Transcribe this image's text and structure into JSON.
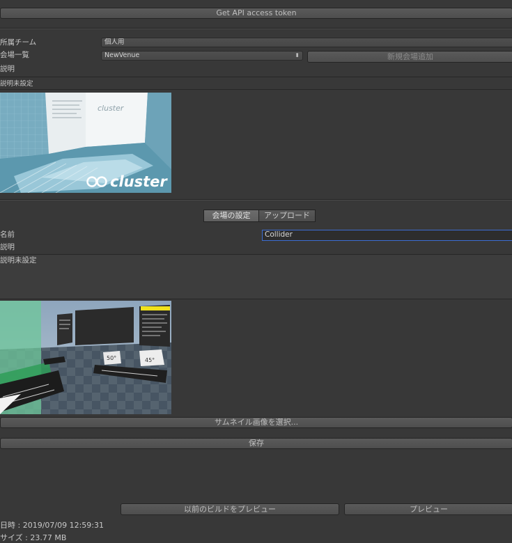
{
  "top": {
    "api_token_button": "Get API access token"
  },
  "team": {
    "label": "所属チーム",
    "value": "個人用"
  },
  "venues": {
    "label": "会場一覧",
    "selected": "NewVenue",
    "add_button": "新規会場追加"
  },
  "venue_description": {
    "label": "説明",
    "value": "説明未設定"
  },
  "venue_thumbnail": {
    "logo_text": "cluster",
    "screen_logo": "cluster"
  },
  "tabs": [
    {
      "label": "会場の設定",
      "active": true
    },
    {
      "label": "アップロード",
      "active": false
    }
  ],
  "settings": {
    "name_label": "名前",
    "name_value": "Collider",
    "description_label": "説明",
    "description_value": "説明未設定",
    "preview_labels": {
      "a": "50°",
      "b": "45°"
    },
    "select_thumbnail_button": "サムネイル画像を選択...",
    "save_button": "保存"
  },
  "build": {
    "preview_previous_button": "以前のビルドをプレビュー",
    "preview_button": "プレビュー",
    "date_text": "日時 : 2019/07/09 12:59:31",
    "size_text": "サイズ : 23.77 MB"
  },
  "colors": {
    "background": "#383838",
    "focus_border": "#3c6dd2",
    "thumb_bg": "#7fb3c6"
  }
}
